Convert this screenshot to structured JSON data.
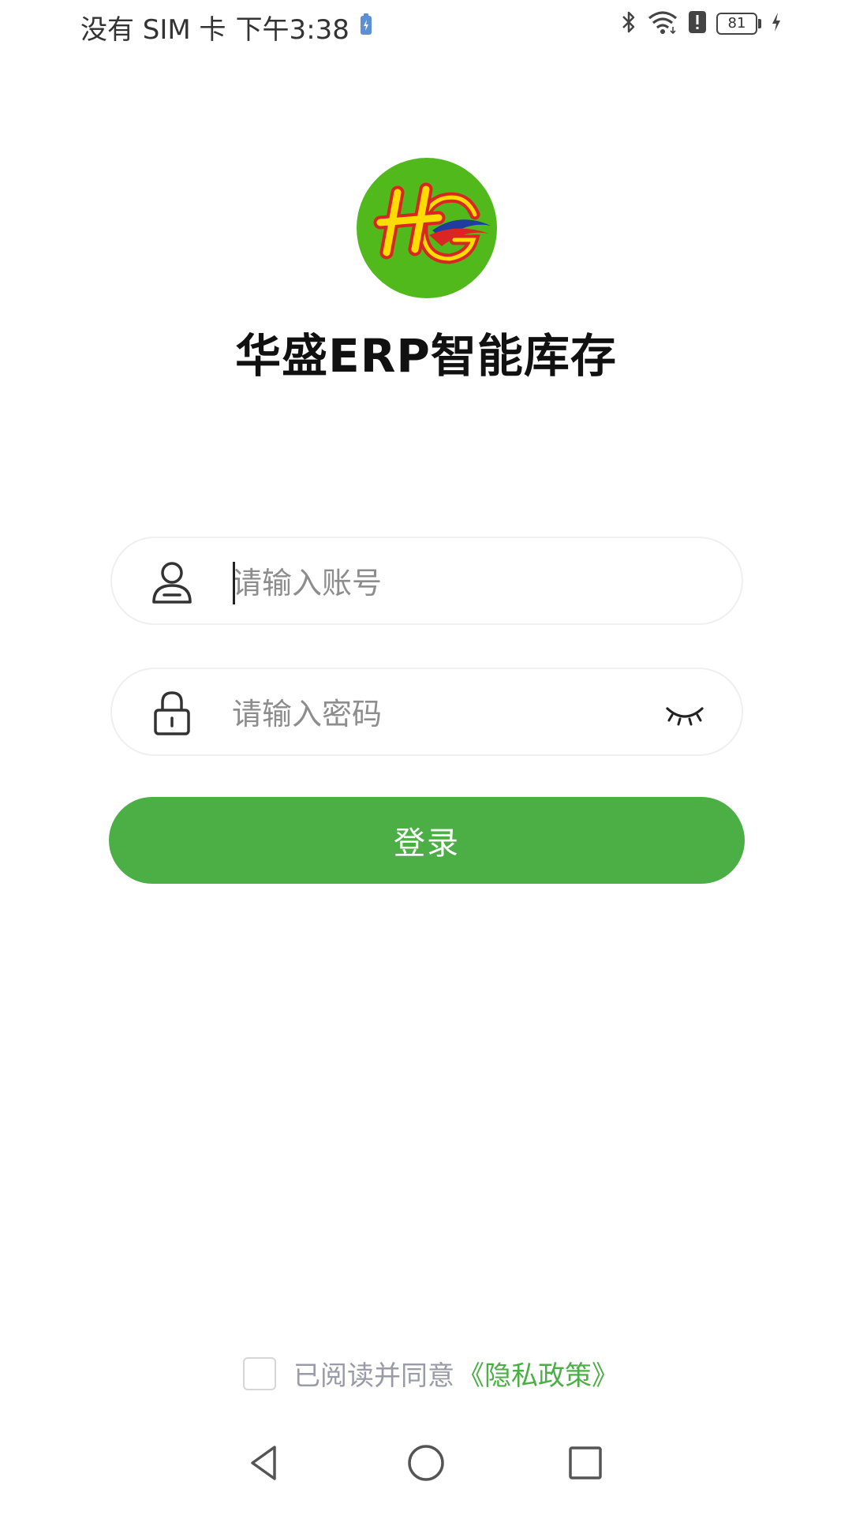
{
  "status_bar": {
    "carrier": "没有 SIM 卡",
    "time": "下午3:38",
    "battery_level": "81",
    "icons": [
      "battery-saver-icon",
      "bluetooth-icon",
      "wifi-icon",
      "alert-icon",
      "battery-icon",
      "charging-icon"
    ]
  },
  "app": {
    "logo_name": "hs-logo",
    "title": "华盛ERP智能库存"
  },
  "login_form": {
    "account_placeholder": "请输入账号",
    "account_value": "",
    "password_placeholder": "请输入密码",
    "password_value": "",
    "login_label": "登录"
  },
  "agreement": {
    "text": "已阅读并同意",
    "policy_link": "《隐私政策》",
    "checked": false
  },
  "colors": {
    "accent": "#4caf46",
    "logo_bg": "#52b91c",
    "text_primary": "#111111",
    "text_secondary": "#9a9ba6"
  }
}
